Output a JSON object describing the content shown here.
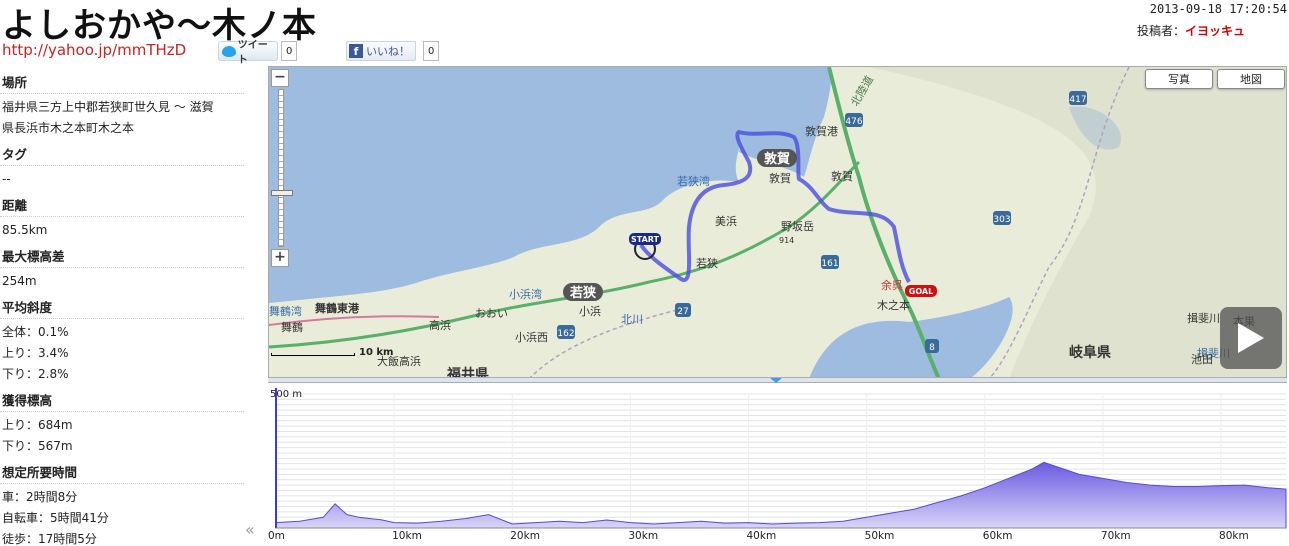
{
  "header": {
    "title": "よしおかや～木ノ本",
    "short_url": "http://yahoo.jp/mmTHzD",
    "tweet_label": "ツイート",
    "tweet_count": "0",
    "like_label": "いいね！",
    "like_count": "0",
    "timestamp": "2013-09-18 17:20:54",
    "poster_label": "投稿者：",
    "poster_name": "イヨッキュ"
  },
  "sidebar": {
    "sections": [
      {
        "heading": "場所",
        "values": [
          "福井県三方上中郡若狭町世久見 ～ 滋賀",
          "県長浜市木之本町木之本"
        ]
      },
      {
        "heading": "タグ",
        "values": [
          "--"
        ]
      },
      {
        "heading": "距離",
        "values": [
          "85.5km"
        ]
      },
      {
        "heading": "最大標高差",
        "values": [
          "254m"
        ]
      },
      {
        "heading": "平均斜度",
        "values": [
          "全体：0.1%",
          "上り：3.4%",
          "下り：2.8%"
        ]
      },
      {
        "heading": "獲得標高",
        "values": [
          "上り：684m",
          "下り：567m"
        ]
      },
      {
        "heading": "想定所要時間",
        "values": [
          "車：2時間8分",
          "自転車：5時間41分",
          "徒歩：17時間5分"
        ]
      }
    ],
    "collapse_glyph": "«"
  },
  "map": {
    "photo_btn": "写真",
    "map_btn": "地図",
    "zoom_in": "+",
    "zoom_out": "−",
    "scale_label": "10 km",
    "start_label": "START",
    "goal_label": "GOAL",
    "labels": [
      {
        "text": "敦賀",
        "key": "tsuruga_big"
      },
      {
        "text": "若狭",
        "key": "wakasa_big"
      },
      {
        "text": "敦賀港",
        "key": "tsurugako"
      },
      {
        "text": "敦賀",
        "key": "tsuruga_st"
      },
      {
        "text": "若狭湾",
        "key": "wakasawan"
      },
      {
        "text": "美浜",
        "key": "mihama"
      },
      {
        "text": "野坂岳",
        "key": "nosakadake"
      },
      {
        "text": "914",
        "key": "elev914"
      },
      {
        "text": "若狭",
        "key": "wakasa_st"
      },
      {
        "text": "小浜湾",
        "key": "obamawan"
      },
      {
        "text": "小浜",
        "key": "obama"
      },
      {
        "text": "小浜西",
        "key": "obamanishi"
      },
      {
        "text": "北川",
        "key": "kitagawa"
      },
      {
        "text": "おおい",
        "key": "ooi"
      },
      {
        "text": "高浜",
        "key": "takahama"
      },
      {
        "text": "舞鶴東港",
        "key": "maizuruhigashi"
      },
      {
        "text": "舞鶴湾",
        "key": "maizuruwan"
      },
      {
        "text": "舞鶴",
        "key": "maizuru"
      },
      {
        "text": "大飯高浜",
        "key": "oitakahama"
      },
      {
        "text": "福井県",
        "key": "fukuiken"
      },
      {
        "text": "北陸道",
        "key": "hokurikudo"
      },
      {
        "text": "敦賀",
        "key": "tsuruga_ic"
      },
      {
        "text": "木之本",
        "key": "kinomoto"
      },
      {
        "text": "余呉",
        "key": "yogo"
      },
      {
        "text": "揖斐川",
        "key": "ibigawa1"
      },
      {
        "text": "揖斐川",
        "key": "ibigawa2"
      },
      {
        "text": "池田",
        "key": "ikeda"
      },
      {
        "text": "岐阜県",
        "key": "gifuken"
      },
      {
        "text": "本巣",
        "key": "motosu"
      },
      {
        "text": "476",
        "key": "r476"
      },
      {
        "text": "417",
        "key": "r417"
      },
      {
        "text": "303",
        "key": "r303"
      },
      {
        "text": "161",
        "key": "r161"
      },
      {
        "text": "27",
        "key": "r27"
      },
      {
        "text": "162",
        "key": "r162"
      },
      {
        "text": "8",
        "key": "r8"
      }
    ]
  },
  "elevation": {
    "y_label": "500 m",
    "x_labels": [
      "0m",
      "10km",
      "20km",
      "30km",
      "40km",
      "50km",
      "60km",
      "70km",
      "80km"
    ]
  },
  "chart_data": {
    "type": "area",
    "title": "",
    "xlabel": "",
    "ylabel": "",
    "x_unit": "km",
    "y_unit": "m",
    "xlim": [
      0,
      85.5
    ],
    "ylim": [
      0,
      500
    ],
    "x": [
      0,
      2,
      4,
      5,
      6,
      7,
      8,
      9,
      10,
      12,
      14,
      16,
      18,
      20,
      22,
      24,
      26,
      28,
      30,
      32,
      34,
      36,
      38,
      40,
      42,
      44,
      46,
      48,
      50,
      52,
      54,
      56,
      58,
      60,
      62,
      64,
      65,
      66,
      68,
      70,
      72,
      74,
      76,
      78,
      80,
      82,
      84,
      85.5
    ],
    "series": [
      {
        "values": [
          20,
          25,
          40,
          90,
          50,
          40,
          35,
          30,
          20,
          18,
          25,
          35,
          50,
          15,
          20,
          25,
          20,
          30,
          20,
          15,
          20,
          25,
          18,
          20,
          15,
          18,
          20,
          25,
          40,
          55,
          70,
          95,
          120,
          150,
          185,
          220,
          245,
          230,
          200,
          185,
          170,
          160,
          155,
          155,
          158,
          160,
          150,
          145
        ]
      }
    ]
  }
}
